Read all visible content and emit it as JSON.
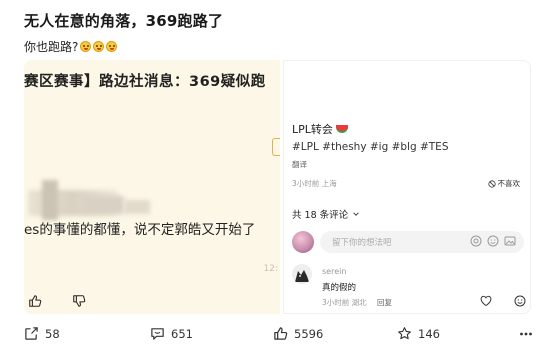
{
  "post": {
    "title": "无人在意的角落，369跑路了",
    "body": "你也跑路?"
  },
  "left_image": {
    "headline": "赛区赛事】路边社消息：369疑似跑",
    "caption": "es的事懂的都懂，说不定郭皓又开始了",
    "time": "12:"
  },
  "right_image": {
    "title": "LPL转会",
    "tags": "#LPL #theshy #ig #blg #TES",
    "translate": "翻译",
    "meta": "3小时前 上海",
    "dislike": "不喜欢",
    "comment_count": "共 18 条评论",
    "input_placeholder": "留下你的想法吧",
    "comment": {
      "name": "serein",
      "text": "真的假的",
      "meta": "3小时前 湖北",
      "reply": "回复"
    }
  },
  "actions": {
    "share": "58",
    "comments": "651",
    "likes": "5596",
    "favorites": "146"
  }
}
